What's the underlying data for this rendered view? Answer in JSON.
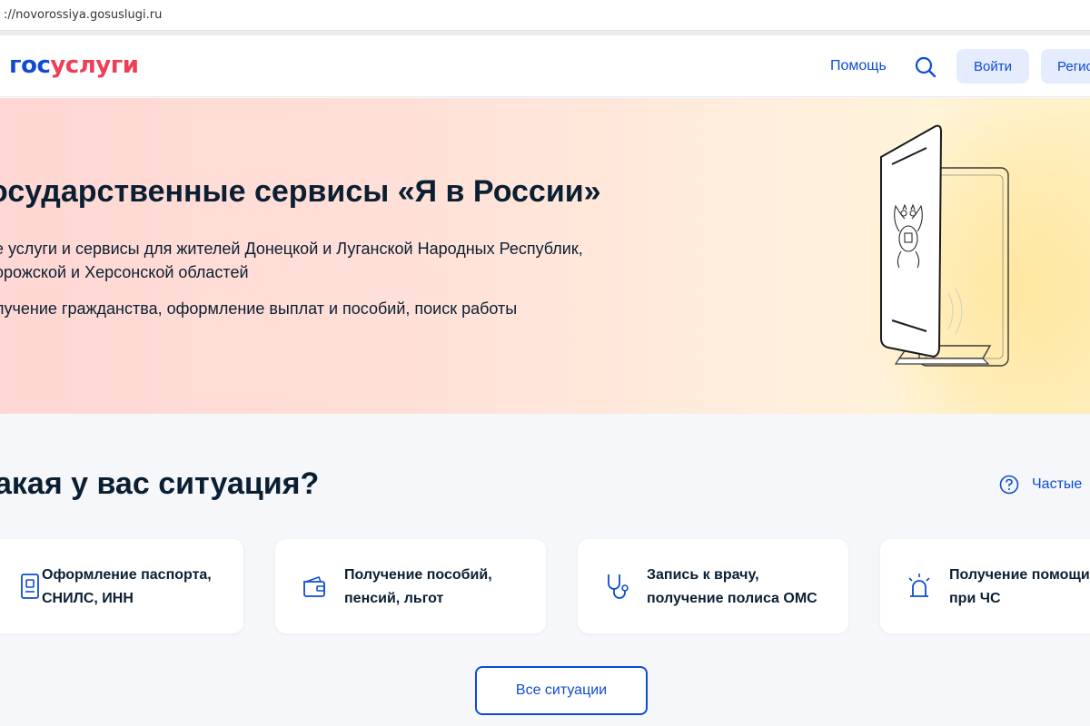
{
  "browser": {
    "url": "://novorossiya.gosuslugi.ru"
  },
  "header": {
    "logo_part1": "гос",
    "logo_part2": "услуги",
    "help": "Помощь",
    "login": "Войти",
    "register": "Регис"
  },
  "hero": {
    "title": "осударственные сервисы «Я в России»",
    "line1": "е услуги и сервисы для жителей Донецкой и Луганской Народных Республик,",
    "line2": "орожской и Херсонской областей",
    "line3": "лучение гражданства, оформление выплат и пособий, поиск работы"
  },
  "situations": {
    "title": "акая у вас ситуация?",
    "faq": "Частые",
    "cards": [
      {
        "text": "Оформление паспорта,\nСНИЛС, ИНН",
        "icon": "passport-icon"
      },
      {
        "text": "Получение пособий,\nпенсий, льгот",
        "icon": "wallet-icon"
      },
      {
        "text": "Запись к врачу,\nполучение полиса ОМС",
        "icon": "stethoscope-icon"
      },
      {
        "text": "Получение помощи\nпри ЧС",
        "icon": "alarm-icon"
      }
    ],
    "all_button": "Все ситуации"
  },
  "colors": {
    "primary": "#0d4cd3",
    "brand_red": "#ee3f58",
    "text": "#0b1f33"
  }
}
